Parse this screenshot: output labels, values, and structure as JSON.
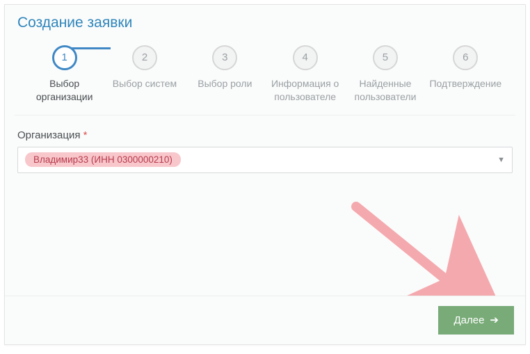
{
  "title": "Создание заявки",
  "steps": [
    {
      "num": "1",
      "label": "Выбор организации",
      "active": true
    },
    {
      "num": "2",
      "label": "Выбор систем",
      "active": false
    },
    {
      "num": "3",
      "label": "Выбор роли",
      "active": false
    },
    {
      "num": "4",
      "label": "Информация о пользователе",
      "active": false
    },
    {
      "num": "5",
      "label": "Найденные пользователи",
      "active": false
    },
    {
      "num": "6",
      "label": "Подтверждение",
      "active": false
    }
  ],
  "form": {
    "org_label": "Организация",
    "required_mark": "*",
    "org_value": "Владимир33 (ИНН 0300000210)"
  },
  "buttons": {
    "next": "Далее"
  }
}
